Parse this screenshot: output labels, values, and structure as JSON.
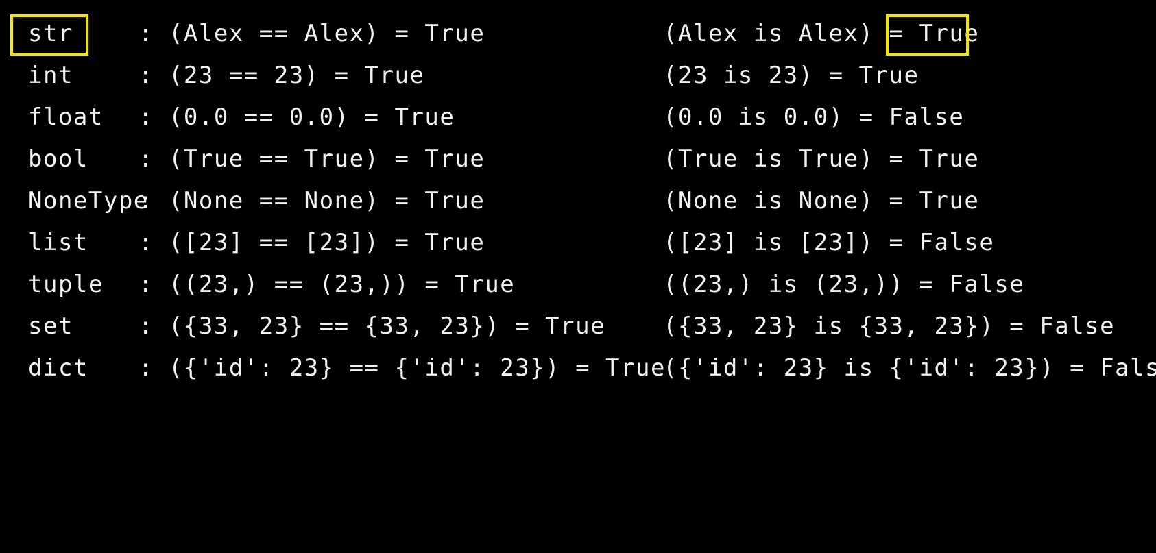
{
  "terminal": {
    "rows": [
      {
        "type": "str",
        "eq": ": (Alex == Alex) = True",
        "is_prefix": "(Alex is Alex) = ",
        "is_result": "True"
      },
      {
        "type": "int",
        "eq": ": (23 == 23) = True",
        "is_prefix": "(23 is 23) = ",
        "is_result": "True"
      },
      {
        "type": "float",
        "eq": ": (0.0 == 0.0) = True",
        "is_prefix": "(0.0 is 0.0) = ",
        "is_result": "False"
      },
      {
        "type": "bool",
        "eq": ": (True == True) = True",
        "is_prefix": "(True is True) = ",
        "is_result": "True"
      },
      {
        "type": "NoneType",
        "eq": ": (None == None) = True",
        "is_prefix": "(None is None) = ",
        "is_result": "True"
      },
      {
        "type": "list",
        "eq": ": ([23] == [23]) = True",
        "is_prefix": "([23] is [23]) = ",
        "is_result": "False"
      },
      {
        "type": "tuple",
        "eq": ": ((23,) == (23,)) = True",
        "is_prefix": "((23,) is (23,)) = ",
        "is_result": "False"
      },
      {
        "type": "set",
        "eq": ": ({33, 23} == {33, 23}) = True",
        "is_prefix": "({33, 23} is {33, 23}) = ",
        "is_result": "False"
      },
      {
        "type": "dict",
        "eq": ": ({'id': 23} == {'id': 23}) = True",
        "is_prefix": "({'id': 23} is {'id': 23}) = ",
        "is_result": "False"
      }
    ]
  },
  "colors": {
    "background": "#000000",
    "text": "#f2f2f2",
    "highlight": "#f5e600"
  }
}
